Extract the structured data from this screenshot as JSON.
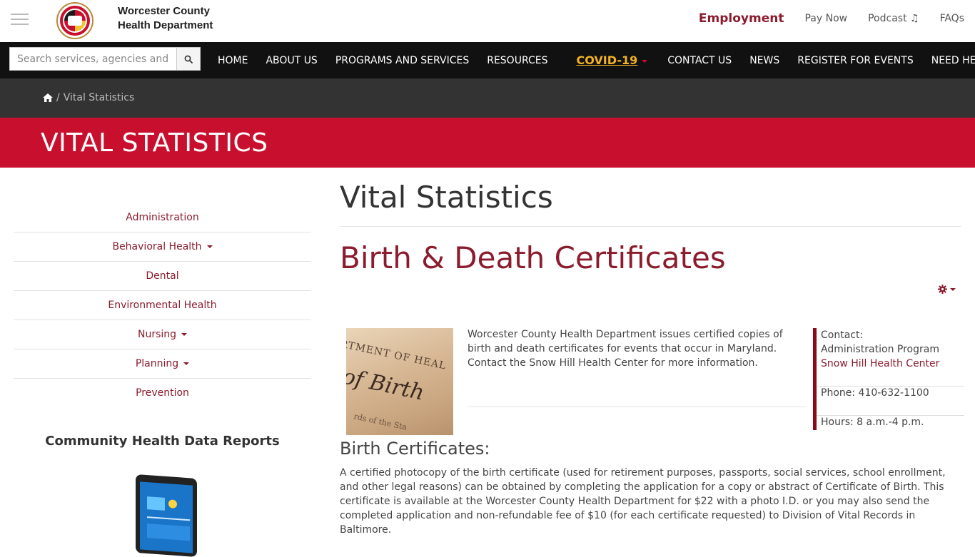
{
  "header": {
    "org_name_line1": "Worcester County",
    "org_name_line2": "Health Department",
    "top_links": {
      "employment": "Employment",
      "pay_now": "Pay Now",
      "podcast": "Podcast ♫",
      "faqs": "FAQs"
    }
  },
  "navbar": {
    "search_placeholder": "Search services, agencies and more...",
    "items": {
      "home": "HOME",
      "about": "ABOUT US",
      "programs": "PROGRAMS AND SERVICES",
      "resources": "RESOURCES",
      "covid": "COVID-19",
      "contact": "CONTACT US",
      "news": "NEWS",
      "register": "REGISTER FOR EVENTS",
      "help": "NEED HELP?"
    }
  },
  "breadcrumb": {
    "separator": "/",
    "current": "Vital Statistics"
  },
  "banner": {
    "title": "VITAL STATISTICS"
  },
  "sidebar": {
    "items": [
      {
        "label": "Administration"
      },
      {
        "label": "Behavioral Health"
      },
      {
        "label": "Dental"
      },
      {
        "label": "Environmental Health"
      },
      {
        "label": "Nursing"
      },
      {
        "label": "Planning"
      },
      {
        "label": "Prevention"
      }
    ],
    "reports_title": "Community Health Data Reports"
  },
  "main": {
    "page_title": "Vital Statistics",
    "section_title": "Birth & Death Certificates",
    "image_text": {
      "line1": "RTMENT OF HEAL",
      "line2": "of Birth",
      "line3": "rds of the Sta"
    },
    "intro_text": "Worcester County Health Department issues certified copies of birth and death certificates for events that occur in Maryland. Contact the Snow Hill Health Center for more information.",
    "contact": {
      "label": "Contact:",
      "program": "Administration Program",
      "location_link": "Snow Hill Health Center",
      "phone": "Phone: 410-632-1100",
      "hours": "Hours: 8 a.m.-4 p.m."
    },
    "birth_heading": "Birth Certificates:",
    "birth_text": "A certified photocopy of the birth certificate (used for retirement purposes, passports, social services, school enrollment, and other legal reasons) can be obtained by completing the application for a copy or abstract of Certificate of Birth. This certificate is available at the Worcester County Health Department for $22 with a photo I.D. or you may also send the completed application and non-refundable fee of $10 (for each certificate requested) to Division of Vital Records in Baltimore."
  },
  "colors": {
    "brand_red": "#c8102e",
    "maroon": "#8b1c2e",
    "nav_bg": "#111111",
    "breadcrumb_bg": "#333333",
    "covid_gold": "#f4b322"
  }
}
